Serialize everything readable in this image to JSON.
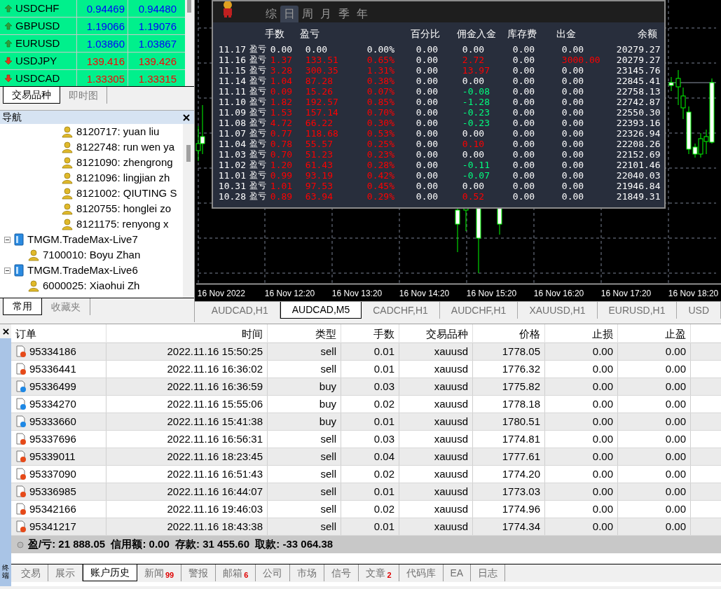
{
  "market_watch": {
    "rows": [
      {
        "symbol": "USDCHF",
        "bid": "0.94469",
        "ask": "0.94480",
        "kind": "up"
      },
      {
        "symbol": "GBPUSD",
        "bid": "1.19066",
        "ask": "1.19076",
        "kind": "up"
      },
      {
        "symbol": "EURUSD",
        "bid": "1.03860",
        "ask": "1.03867",
        "kind": "up"
      },
      {
        "symbol": "USDJPY",
        "bid": "139.416",
        "ask": "139.426",
        "kind": "down"
      },
      {
        "symbol": "USDCAD",
        "bid": "1.33305",
        "ask": "1.33315",
        "kind": "down"
      }
    ],
    "tabs": [
      {
        "label": "交易品种",
        "selected": true
      },
      {
        "label": "即时图",
        "selected": false
      }
    ]
  },
  "navigator": {
    "title": "导航",
    "tree": [
      {
        "children": [
          {
            "label": "8120717: yuan liu"
          },
          {
            "label": "8122748: run wen ya"
          },
          {
            "label": "8121090: zhengrong"
          },
          {
            "label": "8121096: lingjian zh"
          },
          {
            "label": "8121002: QIUTING S"
          },
          {
            "label": "8120755: honglei zo"
          },
          {
            "label": "8121175: renyong x"
          }
        ]
      },
      {
        "label": "TMGM.TradeMax-Live7",
        "expanded": true,
        "children": [
          {
            "label": "7100010: Boyu Zhan"
          }
        ]
      },
      {
        "label": "TMGM.TradeMax-Live6",
        "expanded": true,
        "children": [
          {
            "label": "6000025: Xiaohui Zh"
          }
        ]
      }
    ],
    "tabs": [
      {
        "label": "常用",
        "selected": true
      },
      {
        "label": "收藏夹",
        "selected": false
      }
    ]
  },
  "stats_panel": {
    "periods": [
      {
        "label": "综",
        "selected": false
      },
      {
        "label": "日",
        "selected": true
      },
      {
        "label": "周",
        "selected": false
      },
      {
        "label": "月",
        "selected": false
      },
      {
        "label": "季",
        "selected": false
      },
      {
        "label": "年",
        "selected": false
      }
    ],
    "columns": [
      "手数",
      "盈亏",
      "",
      "百分比",
      "佣金入金",
      "库存费",
      "出金",
      "余额"
    ],
    "rows": [
      {
        "date": "11.17",
        "label": "盈亏",
        "cells": [
          {
            "text": "0.00",
            "color": "#ffffff"
          },
          {
            "text": "0.00",
            "color": "#ffffff"
          },
          {
            "text": "0.00%",
            "color": "#ffffff"
          },
          {
            "text": "0.00",
            "color": "#ffffff"
          },
          {
            "text": "0.00",
            "color": "#ffffff"
          },
          {
            "text": "0.00",
            "color": "#ffffff"
          },
          {
            "text": "0.00",
            "color": "#ffffff"
          },
          {
            "text": "20279.27",
            "color": "#ffffff"
          }
        ]
      },
      {
        "date": "11.16",
        "label": "盈亏",
        "cells": [
          {
            "text": "1.37",
            "color": "#ff0000"
          },
          {
            "text": "133.51",
            "color": "#ff0000"
          },
          {
            "text": "0.65%",
            "color": "#ff0000"
          },
          {
            "text": "0.00",
            "color": "#ffffff"
          },
          {
            "text": "2.72",
            "color": "#ff0000"
          },
          {
            "text": "0.00",
            "color": "#ffffff"
          },
          {
            "text": "3000.00",
            "color": "#ff0000"
          },
          {
            "text": "20279.27",
            "color": "#ffffff"
          }
        ]
      },
      {
        "date": "11.15",
        "label": "盈亏",
        "cells": [
          {
            "text": "3.28",
            "color": "#ff0000"
          },
          {
            "text": "300.35",
            "color": "#ff0000"
          },
          {
            "text": "1.31%",
            "color": "#ff0000"
          },
          {
            "text": "0.00",
            "color": "#ffffff"
          },
          {
            "text": "13.97",
            "color": "#ff0000"
          },
          {
            "text": "0.00",
            "color": "#ffffff"
          },
          {
            "text": "0.00",
            "color": "#ffffff"
          },
          {
            "text": "23145.76",
            "color": "#ffffff"
          }
        ]
      },
      {
        "date": "11.14",
        "label": "盈亏",
        "cells": [
          {
            "text": "1.04",
            "color": "#ff0000"
          },
          {
            "text": "87.28",
            "color": "#ff0000"
          },
          {
            "text": "0.38%",
            "color": "#ff0000"
          },
          {
            "text": "0.00",
            "color": "#ffffff"
          },
          {
            "text": "0.00",
            "color": "#ffffff"
          },
          {
            "text": "0.00",
            "color": "#ffffff"
          },
          {
            "text": "0.00",
            "color": "#ffffff"
          },
          {
            "text": "22845.41",
            "color": "#ffffff"
          }
        ]
      },
      {
        "date": "11.11",
        "label": "盈亏",
        "cells": [
          {
            "text": "0.09",
            "color": "#ff0000"
          },
          {
            "text": "15.26",
            "color": "#ff0000"
          },
          {
            "text": "0.07%",
            "color": "#ff0000"
          },
          {
            "text": "0.00",
            "color": "#ffffff"
          },
          {
            "text": "-0.08",
            "color": "#00ff7f"
          },
          {
            "text": "0.00",
            "color": "#ffffff"
          },
          {
            "text": "0.00",
            "color": "#ffffff"
          },
          {
            "text": "22758.13",
            "color": "#ffffff"
          }
        ]
      },
      {
        "date": "11.10",
        "label": "盈亏",
        "cells": [
          {
            "text": "1.82",
            "color": "#ff0000"
          },
          {
            "text": "192.57",
            "color": "#ff0000"
          },
          {
            "text": "0.85%",
            "color": "#ff0000"
          },
          {
            "text": "0.00",
            "color": "#ffffff"
          },
          {
            "text": "-1.28",
            "color": "#00ff7f"
          },
          {
            "text": "0.00",
            "color": "#ffffff"
          },
          {
            "text": "0.00",
            "color": "#ffffff"
          },
          {
            "text": "22742.87",
            "color": "#ffffff"
          }
        ]
      },
      {
        "date": "11.09",
        "label": "盈亏",
        "cells": [
          {
            "text": "1.53",
            "color": "#ff0000"
          },
          {
            "text": "157.14",
            "color": "#ff0000"
          },
          {
            "text": "0.70%",
            "color": "#ff0000"
          },
          {
            "text": "0.00",
            "color": "#ffffff"
          },
          {
            "text": "-0.23",
            "color": "#00ff7f"
          },
          {
            "text": "0.00",
            "color": "#ffffff"
          },
          {
            "text": "0.00",
            "color": "#ffffff"
          },
          {
            "text": "22550.30",
            "color": "#ffffff"
          }
        ]
      },
      {
        "date": "11.08",
        "label": "盈亏",
        "cells": [
          {
            "text": "4.72",
            "color": "#ff0000"
          },
          {
            "text": "66.22",
            "color": "#ff0000"
          },
          {
            "text": "0.30%",
            "color": "#ff0000"
          },
          {
            "text": "0.00",
            "color": "#ffffff"
          },
          {
            "text": "-0.23",
            "color": "#00ff7f"
          },
          {
            "text": "0.00",
            "color": "#ffffff"
          },
          {
            "text": "0.00",
            "color": "#ffffff"
          },
          {
            "text": "22393.16",
            "color": "#ffffff"
          }
        ]
      },
      {
        "date": "11.07",
        "label": "盈亏",
        "cells": [
          {
            "text": "0.77",
            "color": "#ff0000"
          },
          {
            "text": "118.68",
            "color": "#ff0000"
          },
          {
            "text": "0.53%",
            "color": "#ff0000"
          },
          {
            "text": "0.00",
            "color": "#ffffff"
          },
          {
            "text": "0.00",
            "color": "#ffffff"
          },
          {
            "text": "0.00",
            "color": "#ffffff"
          },
          {
            "text": "0.00",
            "color": "#ffffff"
          },
          {
            "text": "22326.94",
            "color": "#ffffff"
          }
        ]
      },
      {
        "date": "11.04",
        "label": "盈亏",
        "cells": [
          {
            "text": "0.78",
            "color": "#ff0000"
          },
          {
            "text": "55.57",
            "color": "#ff0000"
          },
          {
            "text": "0.25%",
            "color": "#ff0000"
          },
          {
            "text": "0.00",
            "color": "#ffffff"
          },
          {
            "text": "0.10",
            "color": "#ff0000"
          },
          {
            "text": "0.00",
            "color": "#ffffff"
          },
          {
            "text": "0.00",
            "color": "#ffffff"
          },
          {
            "text": "22208.26",
            "color": "#ffffff"
          }
        ]
      },
      {
        "date": "11.03",
        "label": "盈亏",
        "cells": [
          {
            "text": "0.70",
            "color": "#ff0000"
          },
          {
            "text": "51.23",
            "color": "#ff0000"
          },
          {
            "text": "0.23%",
            "color": "#ff0000"
          },
          {
            "text": "0.00",
            "color": "#ffffff"
          },
          {
            "text": "0.00",
            "color": "#ffffff"
          },
          {
            "text": "0.00",
            "color": "#ffffff"
          },
          {
            "text": "0.00",
            "color": "#ffffff"
          },
          {
            "text": "22152.69",
            "color": "#ffffff"
          }
        ]
      },
      {
        "date": "11.02",
        "label": "盈亏",
        "cells": [
          {
            "text": "1.20",
            "color": "#ff0000"
          },
          {
            "text": "61.43",
            "color": "#ff0000"
          },
          {
            "text": "0.28%",
            "color": "#ff0000"
          },
          {
            "text": "0.00",
            "color": "#ffffff"
          },
          {
            "text": "-0.11",
            "color": "#00ff7f"
          },
          {
            "text": "0.00",
            "color": "#ffffff"
          },
          {
            "text": "0.00",
            "color": "#ffffff"
          },
          {
            "text": "22101.46",
            "color": "#ffffff"
          }
        ]
      },
      {
        "date": "11.01",
        "label": "盈亏",
        "cells": [
          {
            "text": "0.99",
            "color": "#ff0000"
          },
          {
            "text": "93.19",
            "color": "#ff0000"
          },
          {
            "text": "0.42%",
            "color": "#ff0000"
          },
          {
            "text": "0.00",
            "color": "#ffffff"
          },
          {
            "text": "-0.07",
            "color": "#00ff7f"
          },
          {
            "text": "0.00",
            "color": "#ffffff"
          },
          {
            "text": "0.00",
            "color": "#ffffff"
          },
          {
            "text": "22040.03",
            "color": "#ffffff"
          }
        ]
      },
      {
        "date": "10.31",
        "label": "盈亏",
        "cells": [
          {
            "text": "1.01",
            "color": "#ff0000"
          },
          {
            "text": "97.53",
            "color": "#ff0000"
          },
          {
            "text": "0.45%",
            "color": "#ff0000"
          },
          {
            "text": "0.00",
            "color": "#ffffff"
          },
          {
            "text": "0.00",
            "color": "#ffffff"
          },
          {
            "text": "0.00",
            "color": "#ffffff"
          },
          {
            "text": "0.00",
            "color": "#ffffff"
          },
          {
            "text": "21946.84",
            "color": "#ffffff"
          }
        ]
      },
      {
        "date": "10.28",
        "label": "盈亏",
        "cells": [
          {
            "text": "0.89",
            "color": "#ff0000"
          },
          {
            "text": "63.94",
            "color": "#ff0000"
          },
          {
            "text": "0.29%",
            "color": "#ff0000"
          },
          {
            "text": "0.00",
            "color": "#ffffff"
          },
          {
            "text": "0.52",
            "color": "#ff0000"
          },
          {
            "text": "0.00",
            "color": "#ffffff"
          },
          {
            "text": "0.00",
            "color": "#ffffff"
          },
          {
            "text": "21849.31",
            "color": "#ffffff"
          }
        ]
      }
    ]
  },
  "chart": {
    "time_labels": [
      "16 Nov 2022",
      "16 Nov 12:20",
      "16 Nov 13:20",
      "16 Nov 14:20",
      "16 Nov 15:20",
      "16 Nov 16:20",
      "16 Nov 17:20",
      "16 Nov 18:20"
    ],
    "tabs": [
      {
        "label": "AUDCAD,H1",
        "selected": false
      },
      {
        "label": "AUDCAD,M5",
        "selected": true
      },
      {
        "label": "CADCHF,H1",
        "selected": false
      },
      {
        "label": "AUDCHF,H1",
        "selected": false
      },
      {
        "label": "XAUUSD,H1",
        "selected": false
      },
      {
        "label": "EURUSD,H1",
        "selected": false
      },
      {
        "label": "USD",
        "selected": false
      }
    ]
  },
  "terminal": {
    "side_label": "终端",
    "table": {
      "columns": [
        "订单",
        "时间",
        "类型",
        "手数",
        "交易品种",
        "价格",
        "止损",
        "止盈"
      ],
      "rows": [
        {
          "kind": "sell",
          "cells": [
            "95334186",
            "2022.11.16 15:50:25",
            "sell",
            "0.01",
            "xauusd",
            "1778.05",
            "0.00",
            "0.00"
          ]
        },
        {
          "kind": "sell",
          "cells": [
            "95336441",
            "2022.11.16 16:36:02",
            "sell",
            "0.01",
            "xauusd",
            "1776.32",
            "0.00",
            "0.00"
          ]
        },
        {
          "kind": "buy",
          "cells": [
            "95336499",
            "2022.11.16 16:36:59",
            "buy",
            "0.03",
            "xauusd",
            "1775.82",
            "0.00",
            "0.00"
          ]
        },
        {
          "kind": "buy",
          "cells": [
            "95334270",
            "2022.11.16 15:55:06",
            "buy",
            "0.02",
            "xauusd",
            "1778.18",
            "0.00",
            "0.00"
          ]
        },
        {
          "kind": "buy",
          "cells": [
            "95333660",
            "2022.11.16 15:41:38",
            "buy",
            "0.01",
            "xauusd",
            "1780.51",
            "0.00",
            "0.00"
          ]
        },
        {
          "kind": "sell",
          "cells": [
            "95337696",
            "2022.11.16 16:56:31",
            "sell",
            "0.03",
            "xauusd",
            "1774.81",
            "0.00",
            "0.00"
          ]
        },
        {
          "kind": "sell",
          "cells": [
            "95339011",
            "2022.11.16 18:23:45",
            "sell",
            "0.04",
            "xauusd",
            "1777.61",
            "0.00",
            "0.00"
          ]
        },
        {
          "kind": "sell",
          "cells": [
            "95337090",
            "2022.11.16 16:51:43",
            "sell",
            "0.02",
            "xauusd",
            "1774.20",
            "0.00",
            "0.00"
          ]
        },
        {
          "kind": "sell",
          "cells": [
            "95336985",
            "2022.11.16 16:44:07",
            "sell",
            "0.01",
            "xauusd",
            "1773.03",
            "0.00",
            "0.00"
          ]
        },
        {
          "kind": "sell",
          "cells": [
            "95342166",
            "2022.11.16 19:46:03",
            "sell",
            "0.02",
            "xauusd",
            "1774.96",
            "0.00",
            "0.00"
          ]
        },
        {
          "kind": "sell",
          "cells": [
            "95341217",
            "2022.11.16 18:43:38",
            "sell",
            "0.01",
            "xauusd",
            "1774.34",
            "0.00",
            "0.00"
          ]
        }
      ]
    },
    "summary": "盈/亏: 21 888.05  信用额: 0.00  存款: 31 455.60  取款: -33 064.38",
    "tabs": [
      {
        "label": "交易",
        "selected": false
      },
      {
        "label": "展示",
        "selected": false
      },
      {
        "label": "账户历史",
        "selected": true
      },
      {
        "label": "新闻",
        "badge": "99",
        "selected": false
      },
      {
        "label": "警报",
        "selected": false
      },
      {
        "label": "邮箱",
        "badge": "6",
        "selected": false
      },
      {
        "label": "公司",
        "selected": false
      },
      {
        "label": "市场",
        "selected": false
      },
      {
        "label": "信号",
        "selected": false
      },
      {
        "label": "文章",
        "badge": "2",
        "selected": false
      },
      {
        "label": "代码库",
        "selected": false
      },
      {
        "label": "EA",
        "selected": false
      },
      {
        "label": "日志",
        "selected": false
      }
    ]
  }
}
